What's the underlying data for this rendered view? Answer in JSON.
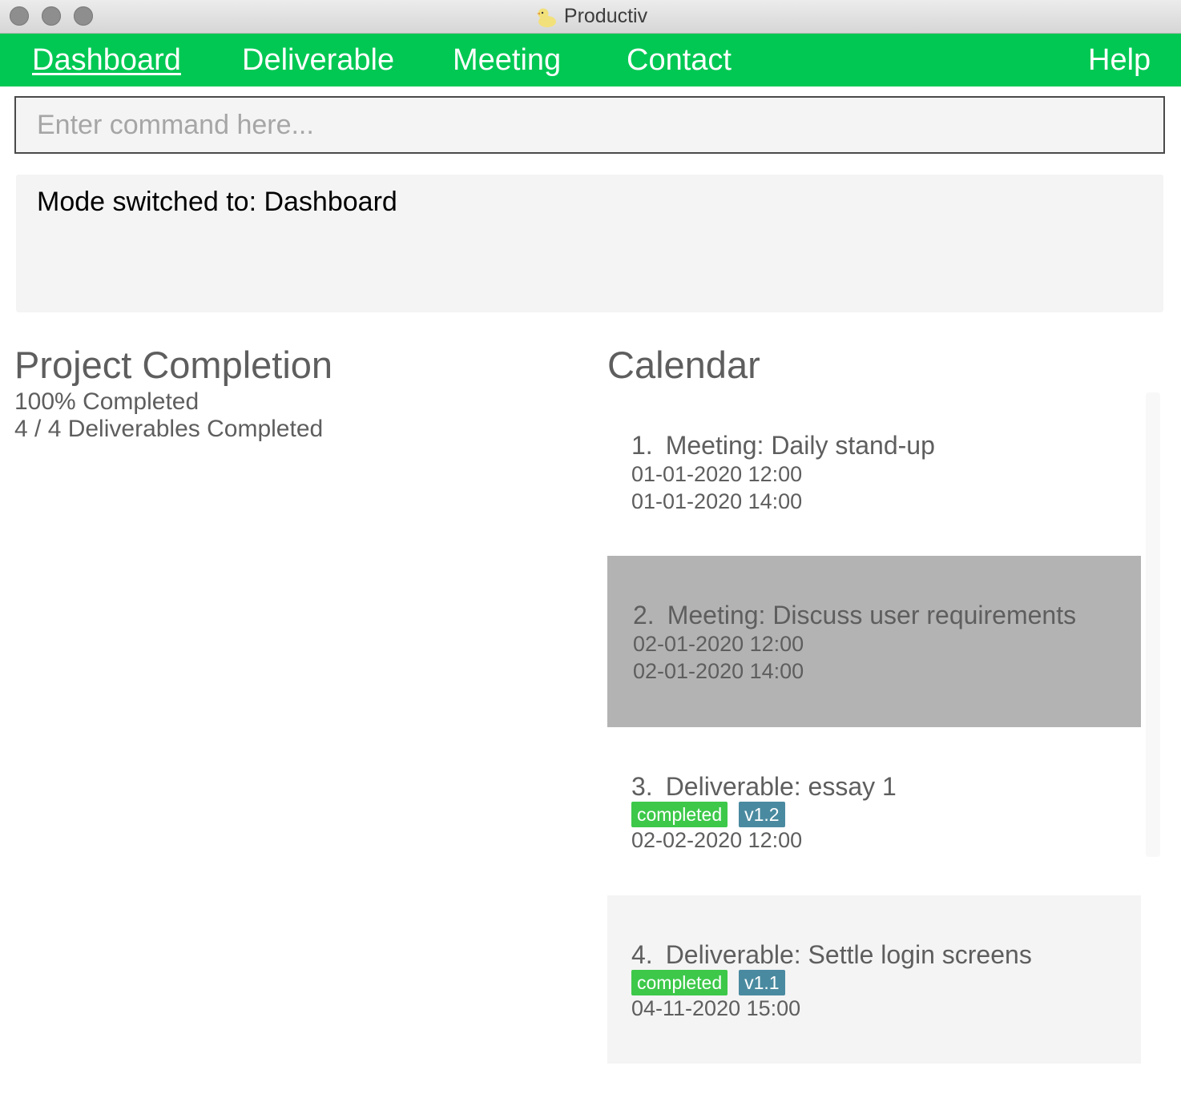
{
  "window": {
    "title": "Productiv",
    "icon": "duck-icon"
  },
  "menu": {
    "items": [
      {
        "label": "Dashboard",
        "active": true
      },
      {
        "label": "Deliverable",
        "active": false
      },
      {
        "label": "Meeting",
        "active": false
      },
      {
        "label": "Contact",
        "active": false
      }
    ],
    "help_label": "Help"
  },
  "command": {
    "placeholder": "Enter command here...",
    "value": ""
  },
  "result": {
    "text": "Mode switched to: Dashboard"
  },
  "completion": {
    "heading": "Project Completion",
    "percent_text": "100% Completed",
    "count_text": "4 / 4 Deliverables Completed"
  },
  "calendar": {
    "heading": "Calendar",
    "items": [
      {
        "index": "1.",
        "title": "Meeting: Daily stand-up",
        "dates": [
          "01-01-2020 12:00",
          "01-01-2020 14:00"
        ],
        "tags": [],
        "selected": false
      },
      {
        "index": "2.",
        "title": "Meeting: Discuss user requirements",
        "dates": [
          "02-01-2020 12:00",
          "02-01-2020 14:00"
        ],
        "tags": [],
        "selected": true
      },
      {
        "index": "3.",
        "title": "Deliverable: essay 1",
        "tags": [
          "completed",
          "v1.2"
        ],
        "dates": [
          "02-02-2020 12:00"
        ],
        "selected": false
      },
      {
        "index": "4.",
        "title": "Deliverable: Settle login screens",
        "tags": [
          "completed",
          "v1.1"
        ],
        "dates": [
          "04-11-2020 15:00"
        ],
        "selected": false
      }
    ]
  },
  "colors": {
    "menu_bar": "#00c853",
    "selected_card": "#b3b3b3",
    "tag_status": "#3dc84a",
    "tag_version": "#4a8aa0"
  }
}
